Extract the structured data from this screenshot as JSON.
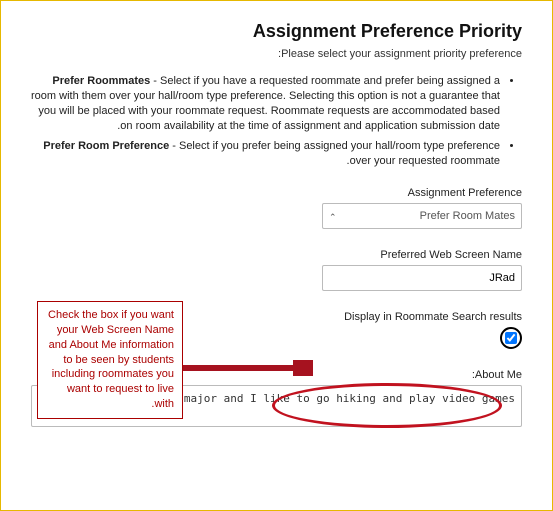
{
  "title": "Assignment Preference Priority",
  "subtitle": "Please select your assignment priority preference:",
  "bullets": [
    {
      "lead": "Prefer Roommates",
      "rest": " - Select if you have a requested roommate and prefer being assigned a room with them over your hall/room type preference. Selecting this option is not a guarantee that you will be placed with your roommate request. Roommate requests are accommodated based on room availability at the time of assignment and application submission date."
    },
    {
      "lead": "Prefer Room Preference",
      "rest": " - Select if you prefer being assigned your hall/room type preference over your requested roommate."
    }
  ],
  "fields": {
    "assignment_pref": {
      "label": "Assignment Preference",
      "value": "Prefer Room Mates"
    },
    "screen_name": {
      "label": "Preferred Web Screen Name",
      "value": "JRad"
    },
    "display_results": {
      "label": "Display in Roommate Search results",
      "checked": true
    },
    "about_me": {
      "label": "About Me:",
      "value": "I am a geology major and I like to go hiking and play video games."
    }
  },
  "annotation": "Check the box if you want your Web Screen Name and About Me information to be seen by students including roommates you want to request to live with."
}
